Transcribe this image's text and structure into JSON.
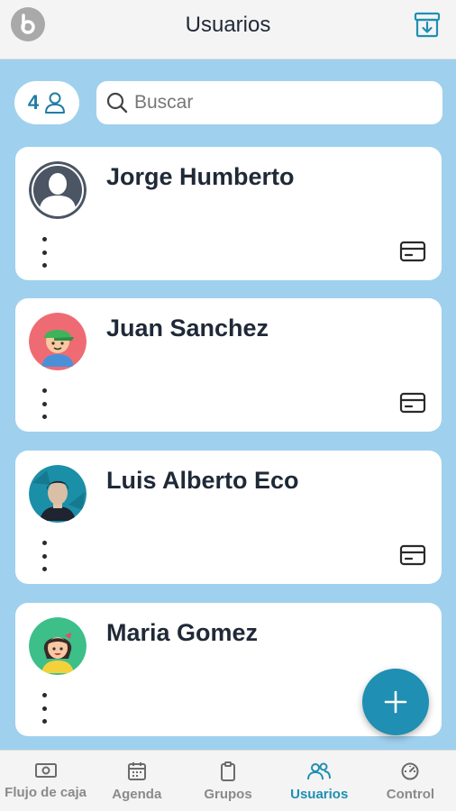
{
  "header": {
    "title": "Usuarios",
    "logo_icon": "brand-logo-icon",
    "action_icon": "archive-download-icon"
  },
  "toolbar": {
    "user_count": "4",
    "search_placeholder": "Buscar"
  },
  "users": [
    {
      "name": "Jorge Humberto",
      "avatar": "default-avatar"
    },
    {
      "name": "Juan Sanchez",
      "avatar": "boy-green-cap-avatar"
    },
    {
      "name": "Luis Alberto Eco",
      "avatar": "man-dark-avatar"
    },
    {
      "name": "Maria Gomez",
      "avatar": "girl-avatar"
    }
  ],
  "fab": {
    "icon": "plus-icon"
  },
  "tabs": [
    {
      "label": "Flujo de caja",
      "icon": "cash-icon",
      "active": false
    },
    {
      "label": "Agenda",
      "icon": "calendar-icon",
      "active": false
    },
    {
      "label": "Grupos",
      "icon": "clipboard-icon",
      "active": false
    },
    {
      "label": "Usuarios",
      "icon": "users-icon",
      "active": true
    },
    {
      "label": "Control",
      "icon": "gauge-icon",
      "active": false
    }
  ],
  "colors": {
    "accent": "#1f8fb3",
    "background": "#9fd0ee",
    "text": "#1f2937"
  }
}
